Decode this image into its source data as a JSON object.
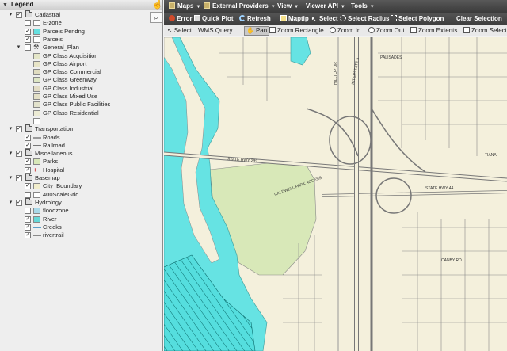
{
  "legend": {
    "title": "Legend",
    "collapse_icon": "collapse-arrow",
    "search_icon": "search-icon",
    "groups": [
      {
        "label": "Cadastral",
        "expanded": true,
        "checked": true,
        "layers": [
          {
            "label": "E-zone",
            "checked": false,
            "swatch": "#ffffff",
            "tool": false
          },
          {
            "label": "Parcels Pendng",
            "checked": true,
            "swatch": "#66e0e0",
            "tool": true
          },
          {
            "label": "Parcels",
            "checked": true,
            "swatch": "#ffffff",
            "tool": false
          },
          {
            "label": "General_Plan",
            "checked": false,
            "swatch": "",
            "tool": true,
            "expandable": true
          }
        ],
        "plan_classes": [
          {
            "label": "GP Class Acquisition",
            "swatch": "#e4e6c8"
          },
          {
            "label": "GP Class Airport",
            "swatch": "#e7e4c6"
          },
          {
            "label": "GP Class Commercial",
            "swatch": "#e0dcc0"
          },
          {
            "label": "GP Class Greenway",
            "swatch": "#dde6c4"
          },
          {
            "label": "GP Class Industrial",
            "swatch": "#e2dcc4"
          },
          {
            "label": "GP Class Mixed Use",
            "swatch": "#e4e0c6"
          },
          {
            "label": "GP Class Public Facilities",
            "swatch": "#e2e2cc"
          },
          {
            "label": "GP Class Residential",
            "swatch": "#ecebd4"
          },
          {
            "label": "",
            "swatch": "#ffffff"
          }
        ]
      },
      {
        "label": "Transportation",
        "expanded": true,
        "checked": true,
        "layers": [
          {
            "label": "Roads",
            "checked": true,
            "symbol": "line",
            "color": "#9a9a9a"
          },
          {
            "label": "Railroad",
            "checked": true,
            "symbol": "rail",
            "color": "#777777"
          }
        ]
      },
      {
        "label": "Miscellaneous",
        "expanded": true,
        "checked": true,
        "layers": [
          {
            "label": "Parks",
            "checked": true,
            "swatch": "#d8e8b8"
          },
          {
            "label": "Hospital",
            "checked": true,
            "symbol": "cross",
            "color": "#cc3333"
          }
        ]
      },
      {
        "label": "Basemap",
        "expanded": true,
        "checked": true,
        "layers": [
          {
            "label": "City_Boundary",
            "checked": true,
            "swatch": "#f2eecc"
          },
          {
            "label": "400ScaleGrid",
            "checked": false,
            "swatch": "#ffffff"
          }
        ]
      },
      {
        "label": "Hydrology",
        "expanded": true,
        "checked": true,
        "layers": [
          {
            "label": "floodzone",
            "checked": false,
            "swatch": "#a9d9e9"
          },
          {
            "label": "River",
            "checked": true,
            "swatch": "#66d8d8"
          },
          {
            "label": "Creeks",
            "checked": true,
            "symbol": "line",
            "color": "#5aa0c8"
          },
          {
            "label": "rivertrail",
            "checked": true,
            "symbol": "line",
            "color": "#8a8a8a"
          }
        ]
      }
    ]
  },
  "menubar": {
    "items": [
      {
        "label": "Maps"
      },
      {
        "label": "External Providers"
      },
      {
        "label": "View"
      },
      {
        "label": "Viewer API"
      },
      {
        "label": "Tools"
      }
    ]
  },
  "actionbar": {
    "items": [
      {
        "label": "Error",
        "icon": "error-icon"
      },
      {
        "label": "Quick Plot",
        "icon": "print-icon"
      },
      {
        "label": "Refresh",
        "icon": "refresh-icon"
      },
      {
        "label": "Maptip",
        "icon": "maptip-icon"
      },
      {
        "label": "Select",
        "icon": "select-icon"
      },
      {
        "label": "Select Radius",
        "icon": "select-radius-icon"
      },
      {
        "label": "Select Polygon",
        "icon": "select-polygon-icon"
      },
      {
        "label": "Clear Selection",
        "icon": ""
      }
    ]
  },
  "toolbar": {
    "items": [
      {
        "label": "Select",
        "active": false
      },
      {
        "label": "WMS Query",
        "active": false
      },
      {
        "label": "Pan",
        "active": true
      },
      {
        "label": "Zoom Rectangle",
        "active": false
      },
      {
        "label": "Zoom In",
        "active": false
      },
      {
        "label": "Zoom Out",
        "active": false
      },
      {
        "label": "Zoom Extents",
        "active": false
      },
      {
        "label": "Zoom Select",
        "active": false
      }
    ]
  },
  "map": {
    "colors": {
      "background": "#f4f0dc",
      "river": "#66e3e3",
      "park": "#d8e8b8",
      "parcel_hatch": "#11aaaa",
      "road": "#777777"
    },
    "labels": {
      "state_hwy_a": "STATE HWY 299",
      "state_hwy_b": "STATE HWY 44",
      "interstate": "INTERSTATE 5",
      "hilltop": "HILLTOP DR",
      "sundial": "SUNDIAL BRIDGE",
      "palisades": "PALISADES",
      "tiana": "TIANA",
      "caldwell": "CALDWELL PARK ACCESS",
      "canby": "CANBY RD"
    }
  }
}
